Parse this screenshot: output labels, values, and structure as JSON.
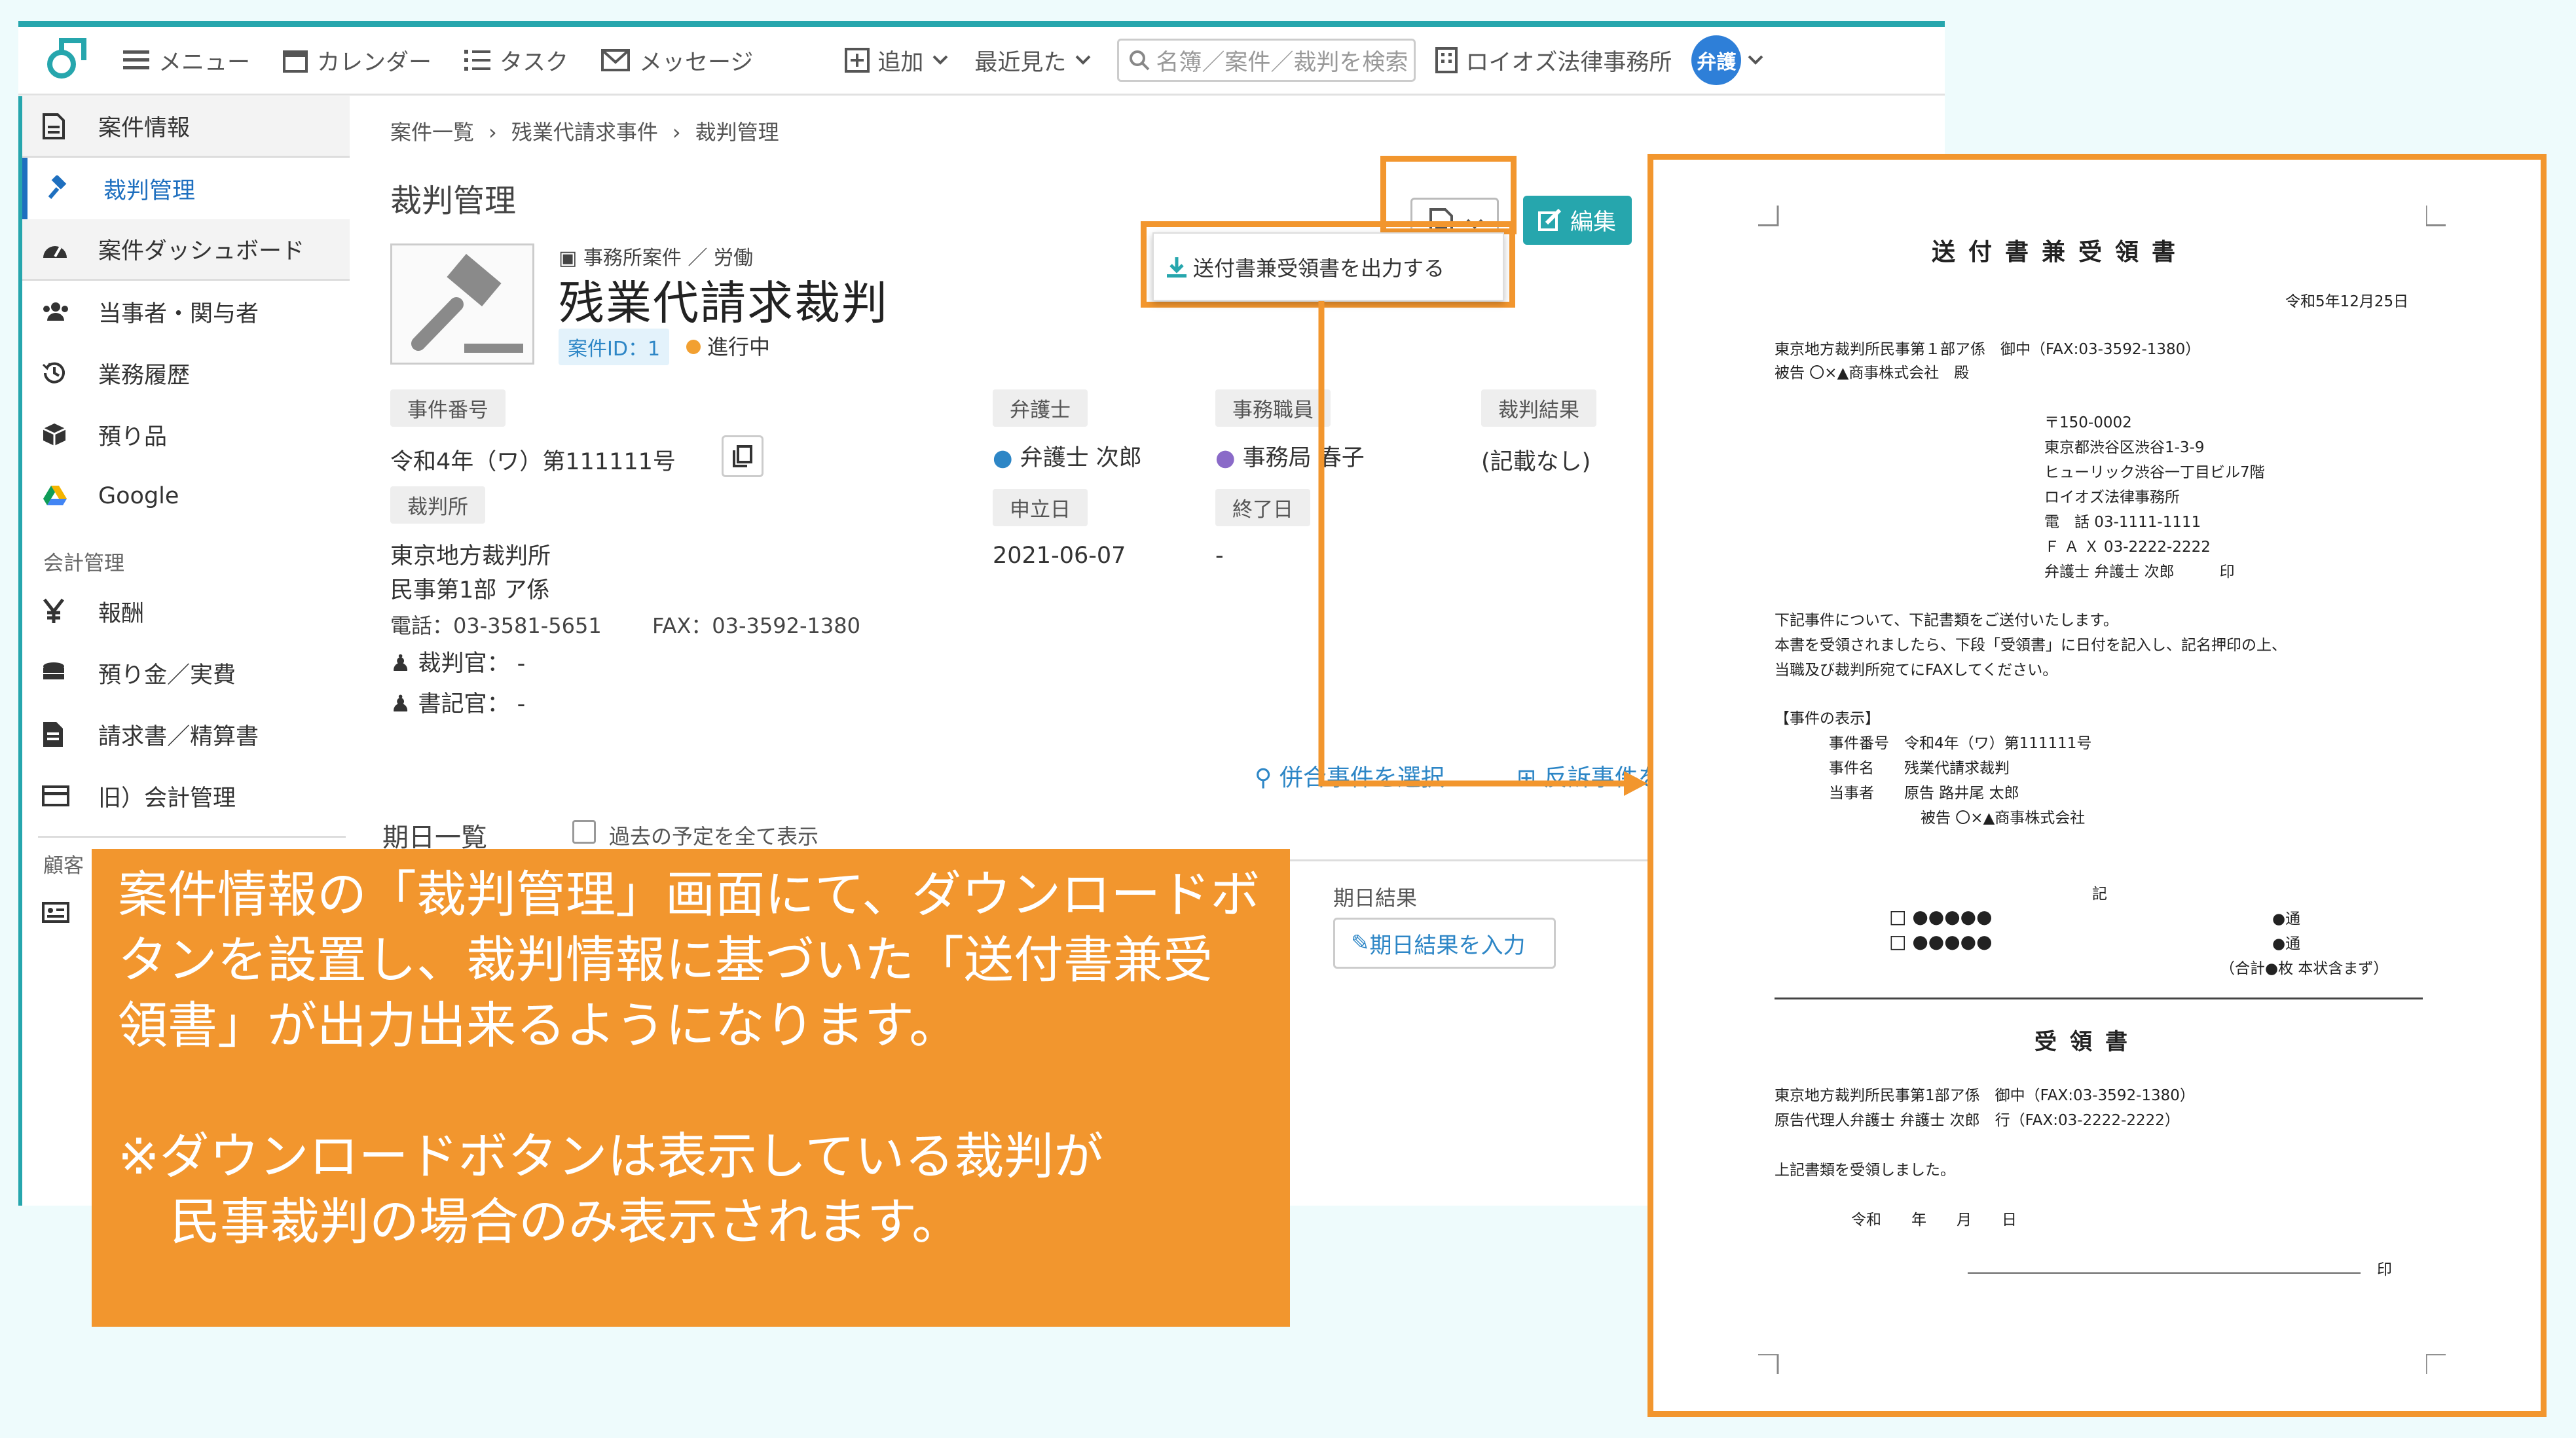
{
  "topbar": {
    "menu": "メニュー",
    "calendar": "カレンダー",
    "tasks": "タスク",
    "messages": "メッセージ",
    "add": "追加",
    "recent": "最近見た",
    "search_placeholder": "名簿／案件／裁判を検索",
    "firm": "ロイオズ法律事務所",
    "avatar": "弁護"
  },
  "sidebar": {
    "items": [
      {
        "label": "案件情報",
        "icon": "document-icon"
      },
      {
        "label": "裁判管理",
        "icon": "gavel-icon"
      },
      {
        "label": "案件ダッシュボード",
        "icon": "dashboard-icon"
      },
      {
        "label": "当事者・関与者",
        "icon": "people-icon"
      },
      {
        "label": "業務履歴",
        "icon": "history-icon"
      },
      {
        "label": "預り品",
        "icon": "box-icon"
      },
      {
        "label": "Google",
        "icon": "google-drive-icon"
      }
    ],
    "group_accounting": "会計管理",
    "accounting_items": [
      {
        "label": "報酬",
        "icon": "yen-icon"
      },
      {
        "label": "預り金／実費",
        "icon": "coins-icon"
      },
      {
        "label": "請求書／精算書",
        "icon": "invoice-icon"
      },
      {
        "label": "旧）会計管理",
        "icon": "card-icon"
      }
    ],
    "group_customer": "顧客"
  },
  "breadcrumb": [
    "案件一覧",
    "残業代請求事件",
    "裁判管理"
  ],
  "page_title": "裁判管理",
  "edit_label": "編集",
  "dropdown_item": "送付書兼受領書を出力する",
  "case": {
    "kind": "事務所案件 ／ 労働",
    "title": "残業代請求裁判",
    "id_badge": "案件ID：1",
    "status": "進行中"
  },
  "fields": {
    "case_number_label": "事件番号",
    "case_number": "令和4年（ワ）第111111号",
    "lawyer_label": "弁護士",
    "lawyer": "弁護士 次郎",
    "staff_label": "事務職員",
    "staff": "事務局 春子",
    "result_label": "裁判結果",
    "result": "(記載なし)",
    "court_label": "裁判所",
    "court_line1": "東京地方裁判所",
    "court_line2": "民事第1部 ア係",
    "court_tel": "電話：03-3581-5651",
    "court_fax": "FAX：03-3592-1380",
    "judge": "裁判官： -",
    "clerk": "書記官： -",
    "filed_label": "申立日",
    "filed": "2021-06-07",
    "end_label": "終了日",
    "end": "-"
  },
  "links": {
    "joint": "併合事件を選択",
    "counter": "反訴事件を"
  },
  "schedule": {
    "title": "期日一覧",
    "show_past": "過去の予定を全て表示",
    "result_label": "期日結果",
    "result_button": "期日結果を入力"
  },
  "callout": {
    "line1": "案件情報の「裁判管理」画面にて、ダウンロードボ",
    "line2": "タンを設置し、裁判情報に基づいた「送付書兼受",
    "line3": "領書」が出力出来るようになります。",
    "line4": "※ダウンロードボタンは表示している裁判が",
    "line5": "民事裁判の場合のみ表示されます。"
  },
  "document": {
    "title": "送付書兼受領書",
    "date": "令和5年12月25日",
    "to1": "東京地方裁判所民事第１部ア係　御中（FAX:03-3592-1380）",
    "to2": "被告 〇×▲商事株式会社　殿",
    "zip": "〒150-0002",
    "addr1": "東京都渋谷区渋谷1-3-9",
    "addr2": "ヒューリック渋谷一丁目ビル7階",
    "firm": "ロイオズ法律事務所",
    "tel": "電　話 03-1111-1111",
    "fax": "Ｆ Ａ Ｘ 03-2222-2222",
    "sign": "弁護士 弁護士 次郎　　　印",
    "body1": "下記事件について、下記書類をご送付いたします。",
    "body2": "本書を受領されましたら、下段「受領書」に日付を記入し、記名押印の上、",
    "body3": "当職及び裁判所宛てにFAXしてください。",
    "case_header": "【事件の表示】",
    "case_no": "事件番号　令和4年（ワ）第111111号",
    "case_name": "事件名　　残業代請求裁判",
    "party1": "当事者　　原告 路井尾 太郎",
    "party2": "被告 〇×▲商事株式会社",
    "ki": "記",
    "item1": "□ ●●●●●",
    "item2": "□ ●●●●●",
    "copies1": "●通",
    "copies2": "●通",
    "total": "（合計●枚 本状含まず）",
    "receipt_title": "受領書",
    "r_to1": "東京地方裁判所民事第1部ア係　御中（FAX:03-3592-1380）",
    "r_to2": "原告代理人弁護士 弁護士 次郎　行（FAX:03-2222-2222）",
    "r_body": "上記書類を受領しました。",
    "r_date": "令和　　年　　月　　日",
    "r_seal": "印"
  }
}
